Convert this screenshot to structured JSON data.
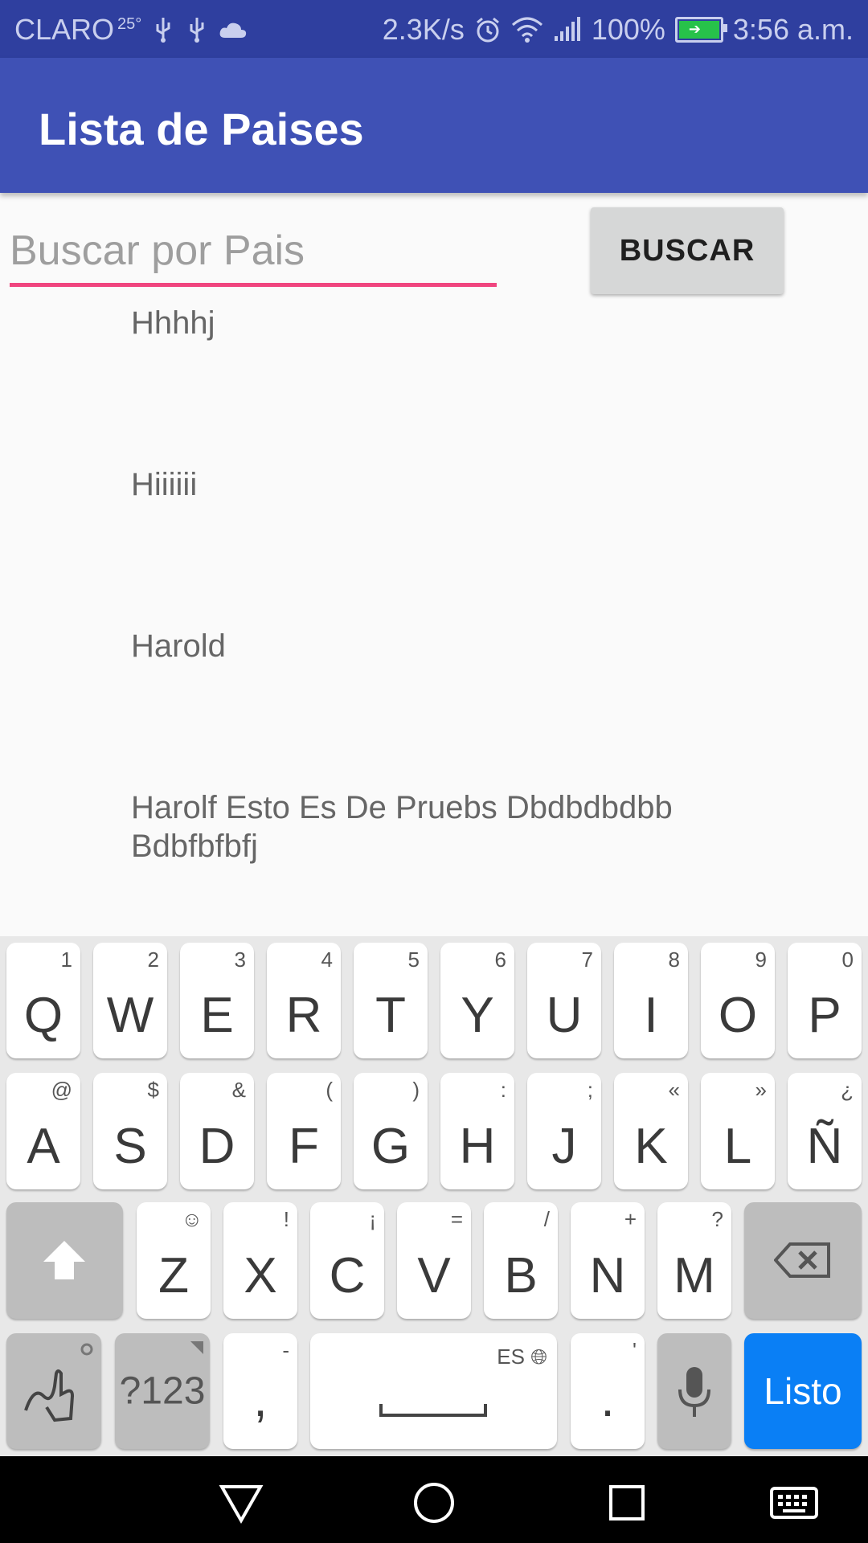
{
  "status_bar": {
    "carrier": "CLARO",
    "temp": "25°",
    "network_speed": "2.3K/s",
    "battery_percent": "100%",
    "time": "3:56 a.m."
  },
  "app_bar": {
    "title": "Lista de Paises"
  },
  "search": {
    "placeholder": "Buscar por Pais",
    "button_label": "BUSCAR"
  },
  "list": {
    "items": [
      "Hhhhj",
      "Hiiiiii",
      "Harold",
      "Harolf Esto Es De Pruebs Dbdbdbdbb Bdbfbfbfj"
    ]
  },
  "keyboard": {
    "row1": [
      {
        "k": "Q",
        "h": "1"
      },
      {
        "k": "W",
        "h": "2"
      },
      {
        "k": "E",
        "h": "3"
      },
      {
        "k": "R",
        "h": "4"
      },
      {
        "k": "T",
        "h": "5"
      },
      {
        "k": "Y",
        "h": "6"
      },
      {
        "k": "U",
        "h": "7"
      },
      {
        "k": "I",
        "h": "8"
      },
      {
        "k": "O",
        "h": "9"
      },
      {
        "k": "P",
        "h": "0"
      }
    ],
    "row2": [
      {
        "k": "A",
        "h": "@"
      },
      {
        "k": "S",
        "h": "$"
      },
      {
        "k": "D",
        "h": "&"
      },
      {
        "k": "F",
        "h": "("
      },
      {
        "k": "G",
        "h": ")"
      },
      {
        "k": "H",
        "h": ":"
      },
      {
        "k": "J",
        "h": ";"
      },
      {
        "k": "K",
        "h": "«"
      },
      {
        "k": "L",
        "h": "»"
      },
      {
        "k": "Ñ",
        "h": "¿"
      }
    ],
    "row3": [
      {
        "k": "Z",
        "h": "☺"
      },
      {
        "k": "X",
        "h": "!"
      },
      {
        "k": "C",
        "h": "¡"
      },
      {
        "k": "V",
        "h": "="
      },
      {
        "k": "B",
        "h": "/"
      },
      {
        "k": "N",
        "h": "+"
      },
      {
        "k": "M",
        "h": "?"
      }
    ],
    "symbols_label": "?123",
    "comma": ",",
    "comma_hint": "-",
    "space_lang": "ES",
    "period": ".",
    "period_hint": "'",
    "done_label": "Listo"
  },
  "icons": {
    "status": [
      "usb-icon",
      "usb-icon",
      "cloud-icon",
      "alarm-icon",
      "wifi-icon",
      "signal-icon",
      "battery-icon"
    ],
    "nav": [
      "back-icon",
      "home-icon",
      "recents-icon",
      "keyboard-icon"
    ]
  },
  "colors": {
    "status_bar": "#2f3f9f",
    "app_bar": "#3f51b5",
    "input_underline": "#f0457f",
    "done_key": "#0a7ff5"
  }
}
